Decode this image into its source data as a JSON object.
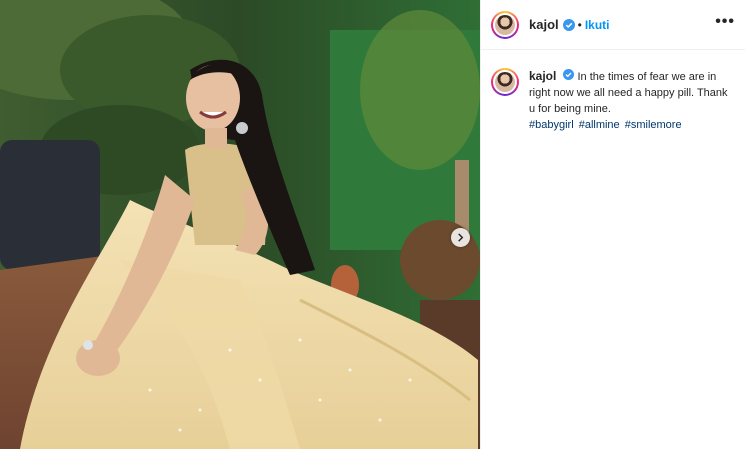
{
  "post": {
    "username": "kajol",
    "follow_label": "Ikuti",
    "separator": "•",
    "more_label": "•••",
    "caption": {
      "username": "kajol",
      "text": "In the times of fear we are in right now we all need a happy pill. Thank u for being mine.",
      "hashtags": [
        "#babygirl",
        "#allmine",
        "#smilemore"
      ]
    }
  },
  "colors": {
    "accent": "#0095f6",
    "hashtag": "#00376b",
    "verified": "#3897f0"
  },
  "icons": {
    "verified": "verified-badge-icon",
    "next": "chevron-right-icon",
    "more": "more-options-icon"
  }
}
